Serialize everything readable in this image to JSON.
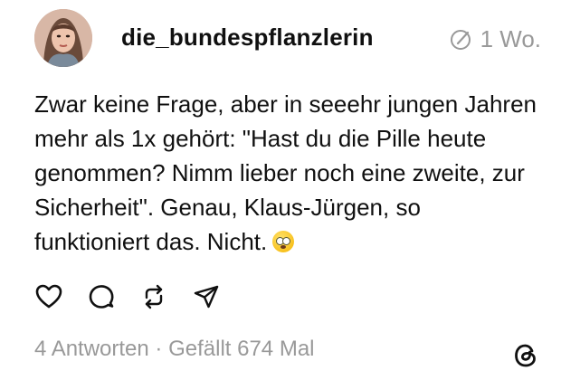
{
  "post": {
    "username": "die_bundespflanzlerin",
    "timestamp": "1 Wo.",
    "text": "Zwar keine Frage, aber in seeehr jungen Jahren mehr als 1x gehört: \"Hast du die Pille heute genommen? Nimm lieber noch eine zweite, zur Sicherheit\". Genau, Klaus-Jürgen, so funktioniert das. Nicht.",
    "emoji": "flushed-face-emoji",
    "stats": "4 Antworten · Gefällt 674 Mal"
  },
  "icons": {
    "edited": "edited-icon",
    "like": "heart-icon",
    "reply": "comment-icon",
    "repost": "repost-icon",
    "share": "share-icon",
    "brand": "threads-logo"
  },
  "colors": {
    "text": "#101010",
    "muted": "#999999",
    "background": "#ffffff"
  }
}
